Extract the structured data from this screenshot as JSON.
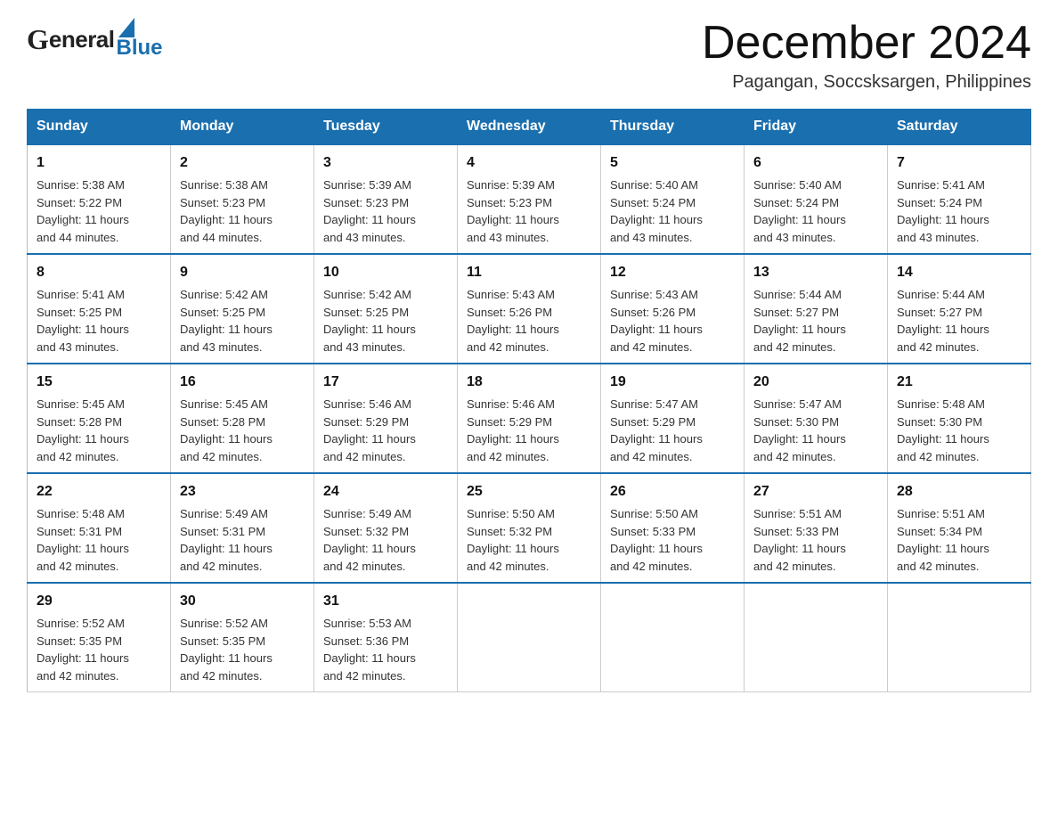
{
  "header": {
    "title": "December 2024",
    "subtitle": "Pagangan, Soccsksargen, Philippines",
    "logo_general": "General",
    "logo_blue": "Blue"
  },
  "calendar": {
    "days_of_week": [
      "Sunday",
      "Monday",
      "Tuesday",
      "Wednesday",
      "Thursday",
      "Friday",
      "Saturday"
    ],
    "weeks": [
      [
        {
          "day": "1",
          "sunrise": "5:38 AM",
          "sunset": "5:22 PM",
          "daylight": "11 hours and 44 minutes."
        },
        {
          "day": "2",
          "sunrise": "5:38 AM",
          "sunset": "5:23 PM",
          "daylight": "11 hours and 44 minutes."
        },
        {
          "day": "3",
          "sunrise": "5:39 AM",
          "sunset": "5:23 PM",
          "daylight": "11 hours and 43 minutes."
        },
        {
          "day": "4",
          "sunrise": "5:39 AM",
          "sunset": "5:23 PM",
          "daylight": "11 hours and 43 minutes."
        },
        {
          "day": "5",
          "sunrise": "5:40 AM",
          "sunset": "5:24 PM",
          "daylight": "11 hours and 43 minutes."
        },
        {
          "day": "6",
          "sunrise": "5:40 AM",
          "sunset": "5:24 PM",
          "daylight": "11 hours and 43 minutes."
        },
        {
          "day": "7",
          "sunrise": "5:41 AM",
          "sunset": "5:24 PM",
          "daylight": "11 hours and 43 minutes."
        }
      ],
      [
        {
          "day": "8",
          "sunrise": "5:41 AM",
          "sunset": "5:25 PM",
          "daylight": "11 hours and 43 minutes."
        },
        {
          "day": "9",
          "sunrise": "5:42 AM",
          "sunset": "5:25 PM",
          "daylight": "11 hours and 43 minutes."
        },
        {
          "day": "10",
          "sunrise": "5:42 AM",
          "sunset": "5:25 PM",
          "daylight": "11 hours and 43 minutes."
        },
        {
          "day": "11",
          "sunrise": "5:43 AM",
          "sunset": "5:26 PM",
          "daylight": "11 hours and 42 minutes."
        },
        {
          "day": "12",
          "sunrise": "5:43 AM",
          "sunset": "5:26 PM",
          "daylight": "11 hours and 42 minutes."
        },
        {
          "day": "13",
          "sunrise": "5:44 AM",
          "sunset": "5:27 PM",
          "daylight": "11 hours and 42 minutes."
        },
        {
          "day": "14",
          "sunrise": "5:44 AM",
          "sunset": "5:27 PM",
          "daylight": "11 hours and 42 minutes."
        }
      ],
      [
        {
          "day": "15",
          "sunrise": "5:45 AM",
          "sunset": "5:28 PM",
          "daylight": "11 hours and 42 minutes."
        },
        {
          "day": "16",
          "sunrise": "5:45 AM",
          "sunset": "5:28 PM",
          "daylight": "11 hours and 42 minutes."
        },
        {
          "day": "17",
          "sunrise": "5:46 AM",
          "sunset": "5:29 PM",
          "daylight": "11 hours and 42 minutes."
        },
        {
          "day": "18",
          "sunrise": "5:46 AM",
          "sunset": "5:29 PM",
          "daylight": "11 hours and 42 minutes."
        },
        {
          "day": "19",
          "sunrise": "5:47 AM",
          "sunset": "5:29 PM",
          "daylight": "11 hours and 42 minutes."
        },
        {
          "day": "20",
          "sunrise": "5:47 AM",
          "sunset": "5:30 PM",
          "daylight": "11 hours and 42 minutes."
        },
        {
          "day": "21",
          "sunrise": "5:48 AM",
          "sunset": "5:30 PM",
          "daylight": "11 hours and 42 minutes."
        }
      ],
      [
        {
          "day": "22",
          "sunrise": "5:48 AM",
          "sunset": "5:31 PM",
          "daylight": "11 hours and 42 minutes."
        },
        {
          "day": "23",
          "sunrise": "5:49 AM",
          "sunset": "5:31 PM",
          "daylight": "11 hours and 42 minutes."
        },
        {
          "day": "24",
          "sunrise": "5:49 AM",
          "sunset": "5:32 PM",
          "daylight": "11 hours and 42 minutes."
        },
        {
          "day": "25",
          "sunrise": "5:50 AM",
          "sunset": "5:32 PM",
          "daylight": "11 hours and 42 minutes."
        },
        {
          "day": "26",
          "sunrise": "5:50 AM",
          "sunset": "5:33 PM",
          "daylight": "11 hours and 42 minutes."
        },
        {
          "day": "27",
          "sunrise": "5:51 AM",
          "sunset": "5:33 PM",
          "daylight": "11 hours and 42 minutes."
        },
        {
          "day": "28",
          "sunrise": "5:51 AM",
          "sunset": "5:34 PM",
          "daylight": "11 hours and 42 minutes."
        }
      ],
      [
        {
          "day": "29",
          "sunrise": "5:52 AM",
          "sunset": "5:35 PM",
          "daylight": "11 hours and 42 minutes."
        },
        {
          "day": "30",
          "sunrise": "5:52 AM",
          "sunset": "5:35 PM",
          "daylight": "11 hours and 42 minutes."
        },
        {
          "day": "31",
          "sunrise": "5:53 AM",
          "sunset": "5:36 PM",
          "daylight": "11 hours and 42 minutes."
        },
        null,
        null,
        null,
        null
      ]
    ],
    "labels": {
      "sunrise": "Sunrise:",
      "sunset": "Sunset:",
      "daylight": "Daylight:"
    }
  },
  "colors": {
    "header_bg": "#1a6faf",
    "header_text": "#ffffff",
    "border": "#bbbbbb",
    "blue_accent": "#1a6faf"
  }
}
